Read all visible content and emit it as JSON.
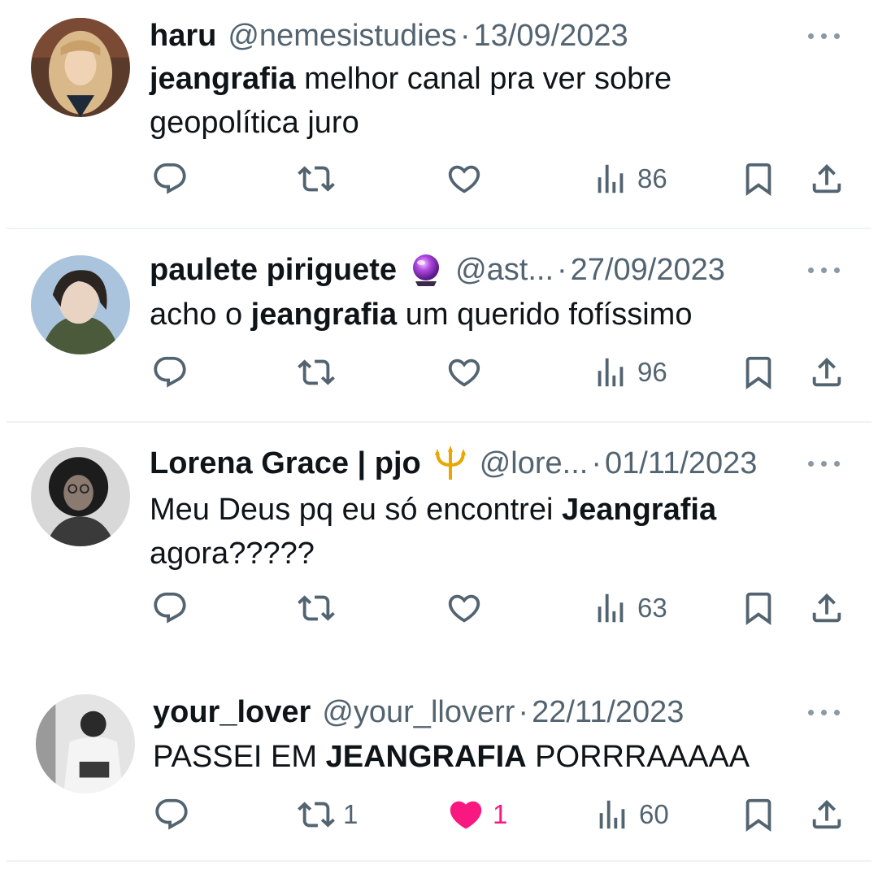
{
  "tweets": [
    {
      "name": "haru",
      "handle": "@nemesistudies",
      "date": "13/09/2023",
      "text_bold": "jeangrafia",
      "text_rest": " melhor canal pra ver sobre geopolítica juro",
      "retweets": "",
      "likes": "",
      "views": "86",
      "liked": false
    },
    {
      "name": "paulete piriguete",
      "emoji": "crystal-ball-icon",
      "handle": "@ast...",
      "date": "27/09/2023",
      "text_pre": "acho o ",
      "text_bold": "jeangrafia",
      "text_rest": " um querido fofíssimo",
      "retweets": "",
      "likes": "",
      "views": "96",
      "liked": false
    },
    {
      "name": "Lorena Grace | pjo",
      "emoji": "trident-icon",
      "handle": "@lore...",
      "date": "01/11/2023",
      "text_pre": "Meu Deus pq eu só encontrei ",
      "text_bold": "Jeangrafia",
      "text_rest": " agora?????",
      "retweets": "",
      "likes": "",
      "views": "63",
      "liked": false
    },
    {
      "name": "your_lover",
      "handle": "@your_lloverr",
      "date": "22/11/2023",
      "text_pre": "PASSEI EM ",
      "text_bold": "JEANGRAFIA",
      "text_rest": " PORRRAAAAA",
      "retweets": "1",
      "likes": "1",
      "views": "60",
      "liked": true
    }
  ],
  "separator": "·",
  "colors": {
    "text": "#0f1419",
    "secondary": "#536471",
    "like": "#f91880",
    "divider": "#eff3f4"
  }
}
